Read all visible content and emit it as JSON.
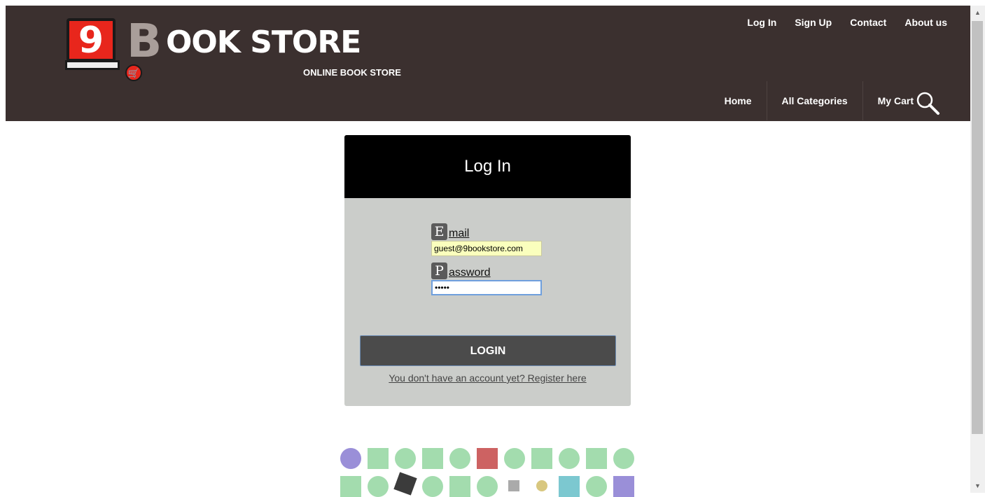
{
  "header": {
    "logo": {
      "number": "9",
      "big_letter": "B",
      "rest_title": "OOK STORE",
      "tagline": "ONLINE BOOK STORE"
    },
    "top_nav": [
      "Log In",
      "Sign Up",
      "Contact",
      "About us"
    ],
    "main_nav": [
      "Home",
      "All Categories",
      "My Cart"
    ]
  },
  "login_card": {
    "title": "Log In",
    "email": {
      "cap": "E",
      "rest": "mail",
      "value": "guest@9bookstore.com"
    },
    "password": {
      "cap": "P",
      "rest": "assword",
      "value": "•••••"
    },
    "button": "LOGIN",
    "register_link": "You don't have an account yet? Register here"
  },
  "colors": {
    "header_bg": "#3b302f",
    "card_bg": "#cbcdca",
    "card_head_bg": "#000000",
    "button_bg": "#4b4b4b"
  }
}
